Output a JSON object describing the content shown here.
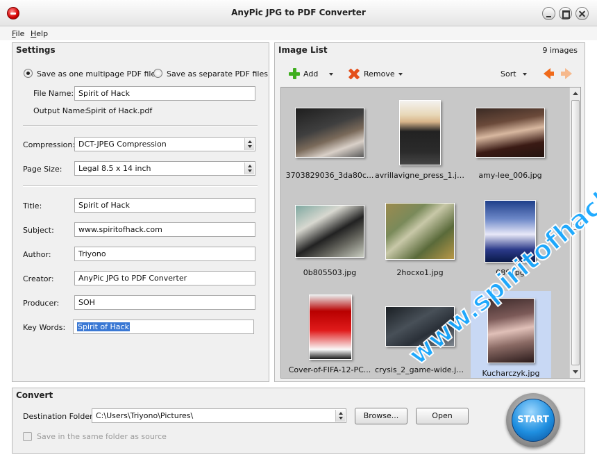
{
  "window": {
    "title": "AnyPic JPG to PDF Converter"
  },
  "menu": {
    "file": "File",
    "help": "Help"
  },
  "settings": {
    "title": "Settings",
    "radio_multipage": "Save as one multipage PDF file",
    "radio_separate": "Save as separate PDF files",
    "file_name_label": "File Name:",
    "file_name_value": "Spirit of Hack",
    "output_name_label": "Output Name:",
    "output_name_value": "Spirit of Hack.pdf",
    "compression_label": "Compression:",
    "compression_value": "DCT-JPEG Compression",
    "page_size_label": "Page Size:",
    "page_size_value": "Legal 8.5 x 14 inch",
    "title_label": "Title:",
    "title_value": "Spirit of Hack",
    "subject_label": "Subject:",
    "subject_value": "www.spiritofhack.com",
    "author_label": "Author:",
    "author_value": "Triyono",
    "creator_label": "Creator:",
    "creator_value": "AnyPic JPG to PDF Converter",
    "producer_label": "Producer:",
    "producer_value": "SOH",
    "keywords_label": "Key Words:",
    "keywords_value": "Spirit of Hack"
  },
  "image_list": {
    "title": "Image List",
    "count": "9 images",
    "add_label": "Add",
    "remove_label": "Remove",
    "sort_label": "Sort",
    "items": [
      {
        "label": "3703829036_3da80c...",
        "style": "img-concert"
      },
      {
        "label": "avrillavigne_press_1.jpg",
        "style": "img-avril"
      },
      {
        "label": "amy-lee_006.jpg",
        "style": "img-amy"
      },
      {
        "label": "0b805503.jpg",
        "style": "img-band"
      },
      {
        "label": "2hocxo1.jpg",
        "style": "img-linkin"
      },
      {
        "label": "080.jpg",
        "style": "img-pes"
      },
      {
        "label": "Cover-of-FIFA-12-PC...",
        "style": "img-fifa"
      },
      {
        "label": "crysis_2_game-wide.jpg",
        "style": "img-crysis"
      },
      {
        "label": "Kucharczyk.jpg",
        "style": "img-kucharczyk"
      }
    ]
  },
  "convert": {
    "title": "Convert",
    "destination_label": "Destination Folder:",
    "destination_value": "C:\\Users\\Triyono\\Pictures\\",
    "browse_label": "Browse...",
    "open_label": "Open",
    "same_folder_label": "Save in the same folder as source",
    "start_label": "START"
  },
  "watermark": "www.spiritofhack.com"
}
